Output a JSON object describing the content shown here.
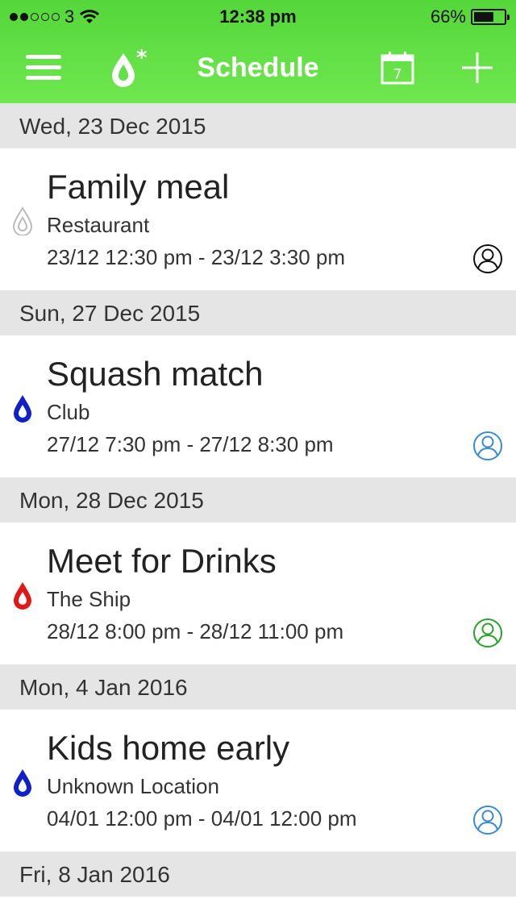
{
  "status_bar": {
    "carrier": "3",
    "time": "12:38 pm",
    "battery": "66%",
    "battery_level": 0.66
  },
  "nav": {
    "title": "Schedule",
    "calendar_day": "7"
  },
  "colors": {
    "header_green": "#5ddc42",
    "blue": "#1020c8",
    "red": "#e01818",
    "green": "#2aa22a",
    "gray": "#bbbbbb"
  },
  "days": [
    {
      "date": "Wed, 23 Dec 2015",
      "event": {
        "title": "Family meal",
        "location": "Restaurant",
        "time": "23/12 12:30 pm - 23/12 3:30 pm",
        "drop_color": "#bbbbbb",
        "drop_style": "outline",
        "person_color": "#111111"
      }
    },
    {
      "date": "Sun, 27 Dec 2015",
      "event": {
        "title": "Squash match",
        "location": "Club",
        "time": "27/12 7:30 pm - 27/12 8:30 pm",
        "drop_color": "#1020c8",
        "drop_style": "solid",
        "person_color": "#3a8ad8"
      }
    },
    {
      "date": "Mon, 28 Dec 2015",
      "event": {
        "title": "Meet for Drinks",
        "location": "The Ship",
        "time": "28/12 8:00 pm - 28/12 11:00 pm",
        "drop_color": "#e01818",
        "drop_style": "solid",
        "person_color": "#2aa22a"
      }
    },
    {
      "date": "Mon, 4 Jan 2016",
      "event": {
        "title": "Kids home early",
        "location": "Unknown Location",
        "time": "04/01 12:00 pm - 04/01 12:00 pm",
        "drop_color": "#1020c8",
        "drop_style": "solid",
        "person_color": "#3a8ad8"
      }
    },
    {
      "date": "Fri, 8 Jan 2016"
    }
  ]
}
